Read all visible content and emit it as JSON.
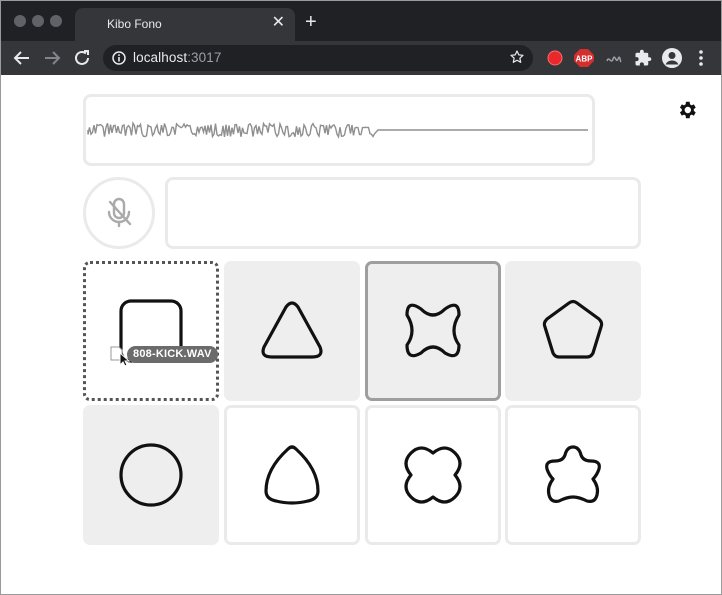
{
  "browser": {
    "tab_title": "Kibo Fono",
    "close_glyph": "✕",
    "new_tab_glyph": "+",
    "url_host": "localhost",
    "url_port": ":3017",
    "extensions": [
      "record-icon",
      "adblock-icon",
      "audio-icon",
      "puzzle-icon",
      "profile-icon",
      "menu-icon"
    ],
    "adblock_label": "ABP"
  },
  "app": {
    "pads": [
      {
        "shape": "rounded-square",
        "state": "dropzone"
      },
      {
        "shape": "rounded-triangle",
        "state": "filled"
      },
      {
        "shape": "cross",
        "state": "selected"
      },
      {
        "shape": "pentagon",
        "state": "filled"
      },
      {
        "shape": "circle",
        "state": "filled"
      },
      {
        "shape": "reuleaux-triangle",
        "state": "outlined"
      },
      {
        "shape": "four-lobe",
        "state": "outlined"
      },
      {
        "shape": "five-lobe",
        "state": "outlined"
      }
    ],
    "dragged_file": "808-KICK.WAV",
    "colors": {
      "pad_fill": "#eeeeee",
      "panel_border": "#eaeaea",
      "selected_border": "#9e9e9e",
      "stroke": "#111111"
    }
  }
}
